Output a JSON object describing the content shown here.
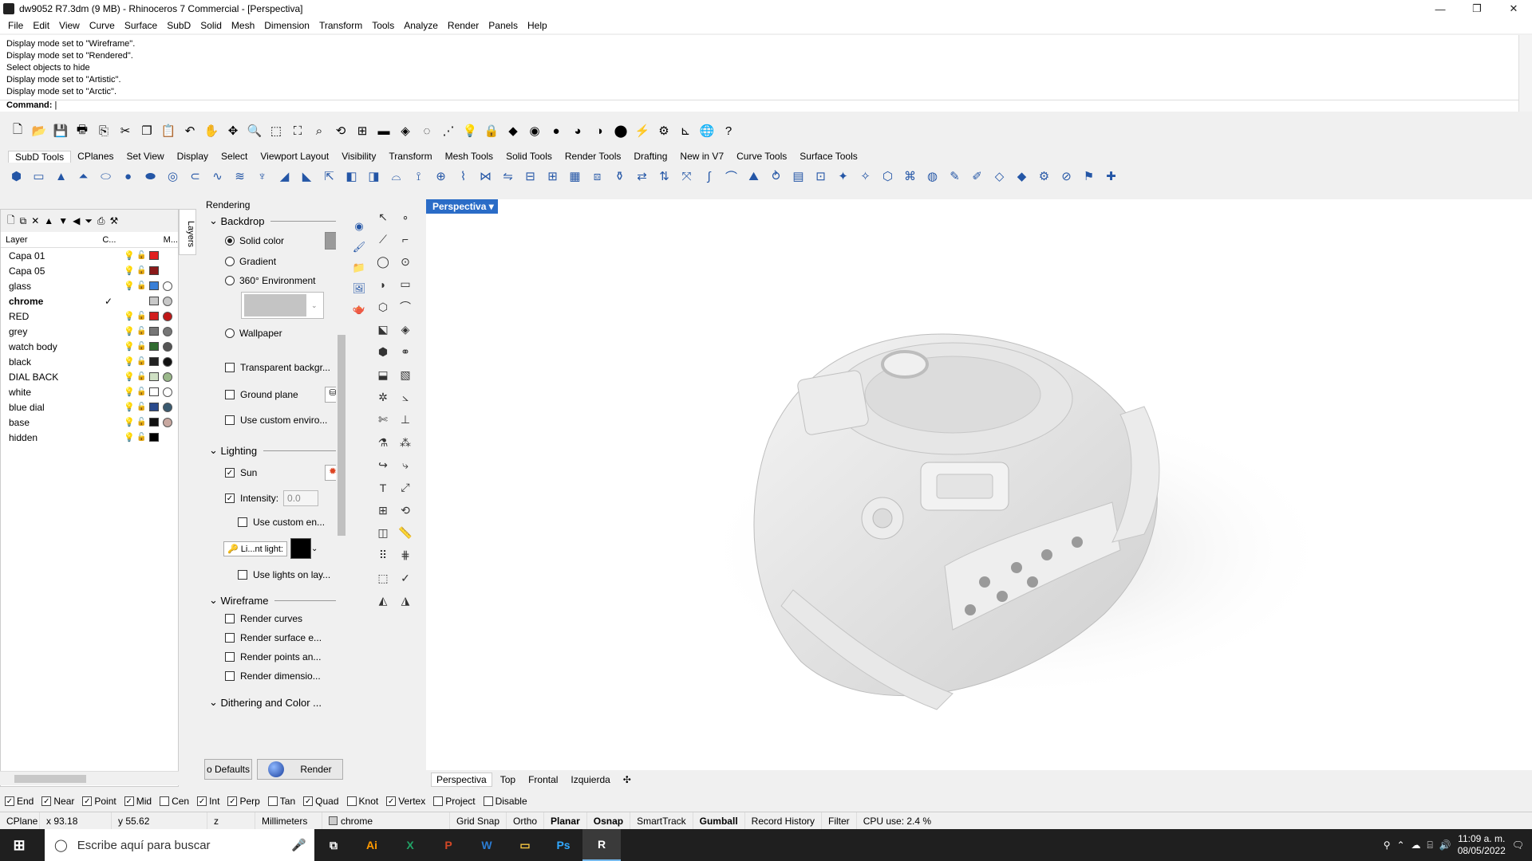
{
  "window": {
    "title": "dw9052 R7.3dm (9 MB) - Rhinoceros 7 Commercial - [Perspectiva]",
    "minimize": "—",
    "maximize": "❐",
    "close": "✕"
  },
  "menu": [
    "File",
    "Edit",
    "View",
    "Curve",
    "Surface",
    "SubD",
    "Solid",
    "Mesh",
    "Dimension",
    "Transform",
    "Tools",
    "Analyze",
    "Render",
    "Panels",
    "Help"
  ],
  "command_history": [
    "Display mode set to \"Wireframe\".",
    "Display mode set to \"Rendered\".",
    "Select objects to hide",
    "Display mode set to \"Artistic\".",
    "Display mode set to \"Arctic\"."
  ],
  "command_prompt": "Command:",
  "toolbar_tabs": [
    "SubD Tools",
    "CPlanes",
    "Set View",
    "Display",
    "Select",
    "Viewport Layout",
    "Visibility",
    "Transform",
    "Mesh Tools",
    "Solid Tools",
    "Render Tools",
    "Drafting",
    "New in V7",
    "Curve Tools",
    "Surface Tools"
  ],
  "layers": {
    "tab_label": "Layers",
    "col_layer": "Layer",
    "col_c": "C...",
    "col_m": "M...",
    "current_mark": "✓",
    "rows": [
      {
        "name": "Capa 01",
        "color": "#e02020",
        "mat": null,
        "current": false
      },
      {
        "name": "Capa 05",
        "color": "#8b1a1a",
        "mat": null,
        "current": false
      },
      {
        "name": "glass",
        "color": "#3a7fd6",
        "mat": "#ffffff",
        "current": false
      },
      {
        "name": "chrome",
        "color": "#c8c8c8",
        "mat": "#c8c8c8",
        "current": true
      },
      {
        "name": "RED",
        "color": "#d21e1e",
        "mat": "#c01818",
        "current": false
      },
      {
        "name": "grey",
        "color": "#777777",
        "mat": "#777777",
        "current": false
      },
      {
        "name": "watch body",
        "color": "#2f6b2f",
        "mat": "#555555",
        "current": false
      },
      {
        "name": "black",
        "color": "#222222",
        "mat": "#111111",
        "current": false
      },
      {
        "name": "DIAL BACK",
        "color": "#cfe0c4",
        "mat": "#9ab88a",
        "current": false
      },
      {
        "name": "white",
        "color": "#ffffff",
        "mat": "#ffffff",
        "current": false
      },
      {
        "name": "blue dial",
        "color": "#2a4a8c",
        "mat": "#3a5a70",
        "current": false
      },
      {
        "name": "base",
        "color": "#111111",
        "mat": "#c8a8a0",
        "current": false
      },
      {
        "name": "hidden",
        "color": "#000000",
        "mat": null,
        "current": false
      }
    ]
  },
  "rendering": {
    "title": "Rendering",
    "backdrop": {
      "label": "Backdrop",
      "solid": "Solid color",
      "gradient": "Gradient",
      "env": "360° Environment",
      "wallpaper": "Wallpaper",
      "transparent": "Transparent backgr...",
      "ground": "Ground plane",
      "custom_env": "Use custom enviro..."
    },
    "lighting": {
      "label": "Lighting",
      "sun": "Sun",
      "intensity_label": "Intensity:",
      "intensity_value": "0.0",
      "custom_en": "Use custom en...",
      "light_label": "Li...nt light:",
      "use_lights": "Use lights on lay..."
    },
    "wireframe": {
      "label": "Wireframe",
      "curves": "Render curves",
      "surface": "Render surface e...",
      "points": "Render points an...",
      "dimensions": "Render dimensio..."
    },
    "dithering": "Dithering and Color ...",
    "defaults_btn": "o Defaults",
    "render_btn": "Render"
  },
  "viewport": {
    "title": "Perspectiva",
    "tabs": [
      "Perspectiva",
      "Top",
      "Frontal",
      "Izquierda"
    ]
  },
  "osnaps": [
    {
      "label": "End",
      "on": true
    },
    {
      "label": "Near",
      "on": true
    },
    {
      "label": "Point",
      "on": true
    },
    {
      "label": "Mid",
      "on": true
    },
    {
      "label": "Cen",
      "on": false
    },
    {
      "label": "Int",
      "on": true
    },
    {
      "label": "Perp",
      "on": true
    },
    {
      "label": "Tan",
      "on": false
    },
    {
      "label": "Quad",
      "on": true
    },
    {
      "label": "Knot",
      "on": false
    },
    {
      "label": "Vertex",
      "on": true
    },
    {
      "label": "Project",
      "on": false
    },
    {
      "label": "Disable",
      "on": false
    }
  ],
  "status": {
    "cplane": "CPlane",
    "x": "x 93.18",
    "y": "y 55.62",
    "z": "z",
    "units": "Millimeters",
    "layer": "chrome",
    "grid_snap": "Grid Snap",
    "ortho": "Ortho",
    "planar": "Planar",
    "osnap": "Osnap",
    "smarttrack": "SmartTrack",
    "gumball": "Gumball",
    "record": "Record History",
    "filter": "Filter",
    "cpu": "CPU use: 2.4 %"
  },
  "taskbar": {
    "search_placeholder": "Escribe aquí para buscar",
    "apps": [
      "Ai",
      "X",
      "P",
      "W",
      "▭",
      "Ps",
      "R"
    ],
    "time": "11:09 a. m.",
    "date": "08/05/2022"
  }
}
